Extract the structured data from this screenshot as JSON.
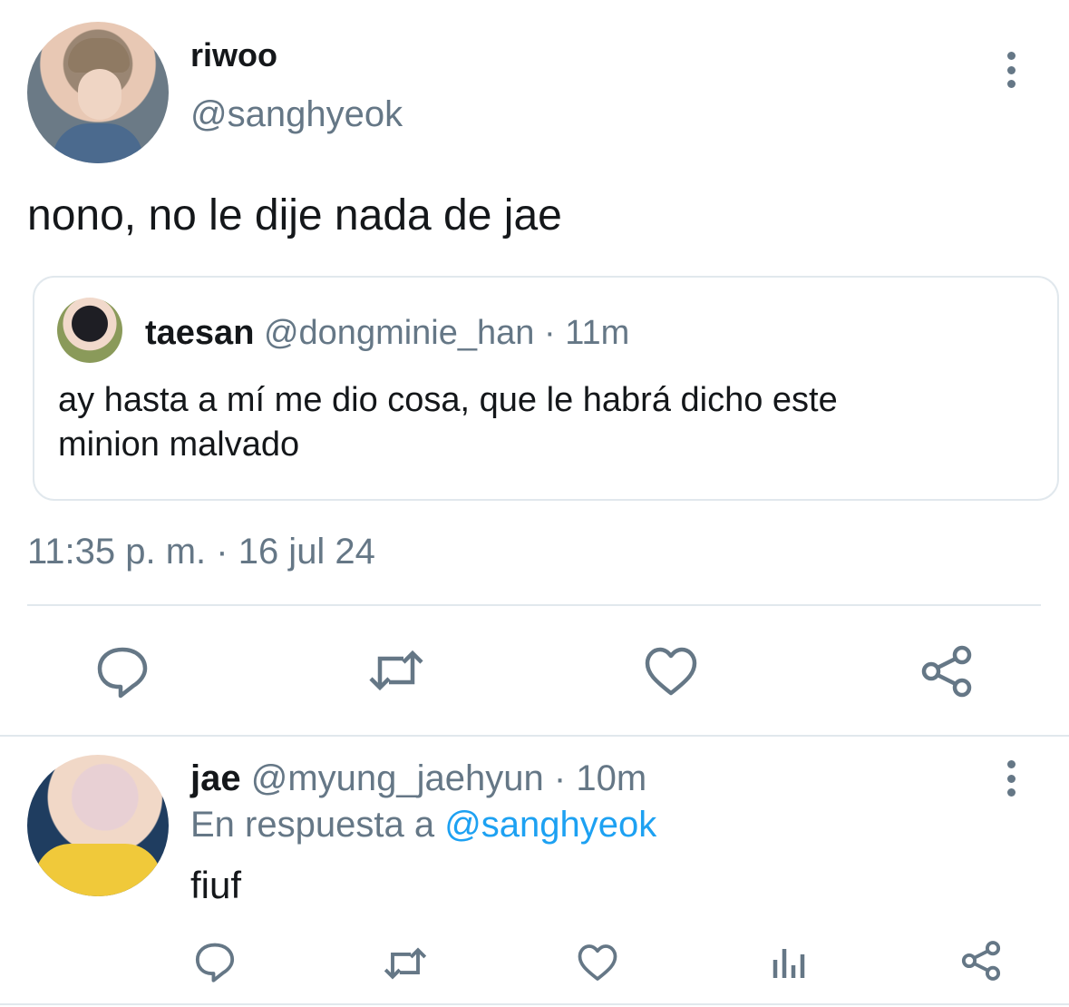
{
  "main_tweet": {
    "display_name": "riwoo",
    "handle": "@sanghyeok",
    "text": "nono, no le dije nada de jae",
    "quoted": {
      "display_name": "taesan",
      "handle": "@dongminie_han",
      "time": "· 11m",
      "text_line1": "ay hasta a mí me dio cosa, que le habrá dicho este",
      "text_line2": "minion malvado"
    },
    "timestamp": "11:35 p. m. · 16 jul 24",
    "actions": [
      "reply-icon",
      "retweet-icon",
      "like-icon",
      "share-icon"
    ]
  },
  "reply_tweet": {
    "display_name": "jae",
    "handle": "@myung_jaehyun",
    "time": "· 10m",
    "reply_prefix": "En respuesta a",
    "reply_to": "@sanghyeok",
    "text": "fiuf",
    "actions": [
      "reply-icon",
      "retweet-icon",
      "like-icon",
      "analytics-icon",
      "share-icon"
    ]
  },
  "colors": {
    "text": "#14171a",
    "secondary": "#657786",
    "link": "#1da1f2",
    "border": "#e1e8ed"
  }
}
